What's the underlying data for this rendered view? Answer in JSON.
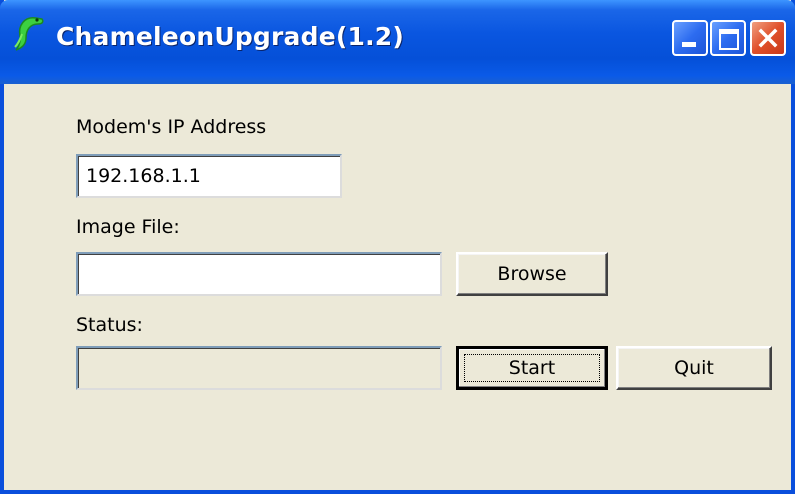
{
  "window": {
    "title": "ChameleonUpgrade(1.2)",
    "icon": "chameleon-icon",
    "controls": [
      "minimize-icon",
      "maximize-icon",
      "close-icon"
    ]
  },
  "form": {
    "ip_label": "Modem's IP Address",
    "ip_value": "192.168.1.1",
    "image_label": "Image File:",
    "image_value": "",
    "status_label": "Status:",
    "status_value": ""
  },
  "buttons": {
    "browse": "Browse",
    "start": "Start",
    "quit": "Quit"
  },
  "colors": {
    "titlebar": "#0a56e0",
    "close_button": "#e0502a",
    "window_bg": "#ece9d8"
  }
}
